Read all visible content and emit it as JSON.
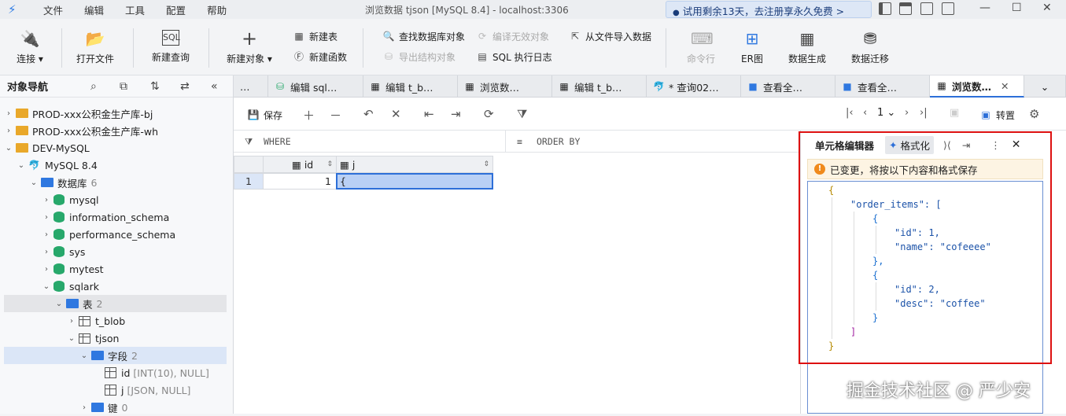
{
  "titlebar": {
    "menus": [
      "文件",
      "编辑",
      "工具",
      "配置",
      "帮助"
    ],
    "title": "浏览数据 tjson [MySQL 8.4]  - localhost:3306",
    "trial": "试用剩余13天，去注册享永久免费 >"
  },
  "toolbar": {
    "connect": "连接",
    "open_file": "打开文件",
    "new_query": "新建查询",
    "new_object": "新建对象",
    "new_table": "新建表",
    "new_function": "新建函数",
    "find_object": "查找数据库对象",
    "compile_invalid": "编译无效对象",
    "export_structure": "导出结构对象",
    "sql_log": "SQL 执行日志",
    "import_from_file": "从文件导入数据",
    "command_line": "命令行",
    "er_diagram": "ER图",
    "data_gen": "数据生成",
    "data_migrate": "数据迁移"
  },
  "nav": {
    "title": "对象导航",
    "tree": [
      {
        "label": "PROD-xxx公积金生产库-bj"
      },
      {
        "label": "PROD-xxx公积金生产库-wh"
      },
      {
        "label": "DEV-MySQL"
      },
      {
        "label": "MySQL 8.4"
      },
      {
        "label": "数据库",
        "count": "6"
      },
      {
        "label": "mysql"
      },
      {
        "label": "information_schema"
      },
      {
        "label": "performance_schema"
      },
      {
        "label": "sys"
      },
      {
        "label": "mytest"
      },
      {
        "label": "sqlark"
      },
      {
        "label": "表",
        "count": "2"
      },
      {
        "label": "t_blob"
      },
      {
        "label": "tjson"
      },
      {
        "label": "字段",
        "count": "2"
      },
      {
        "label": "id",
        "meta": "[INT(10), NULL]"
      },
      {
        "label": "j",
        "meta": "[JSON, NULL]"
      },
      {
        "label": "键",
        "count": "0"
      }
    ]
  },
  "tabs": [
    "…",
    "编辑 sql…",
    "编辑 t_b…",
    "浏览数…",
    "编辑 t_b…",
    "* 查询02…",
    "查看全…",
    "查看全…",
    "浏览数…"
  ],
  "editor_toolbar": {
    "save": "保存",
    "page": "1",
    "transpose": "转置"
  },
  "filter": {
    "where": "WHERE",
    "order_by": "ORDER BY"
  },
  "grid": {
    "columns": [
      "id",
      "j"
    ],
    "rows": [
      {
        "rownum": "1",
        "id": "1",
        "j": "{"
      }
    ]
  },
  "cell_editor": {
    "title": "单元格编辑器",
    "format": "格式化",
    "warning": "已变更，将按以下内容和格式保存",
    "json_lines": [
      "{",
      "\"order_items\": [",
      "{",
      "\"id\": 1,",
      "\"name\": \"cofeeee\"",
      "},",
      "{",
      "\"id\": 2,",
      "\"desc\": \"coffee\"",
      "}",
      "]",
      "}"
    ]
  },
  "watermark": "掘金技术社区 @ 严少安"
}
